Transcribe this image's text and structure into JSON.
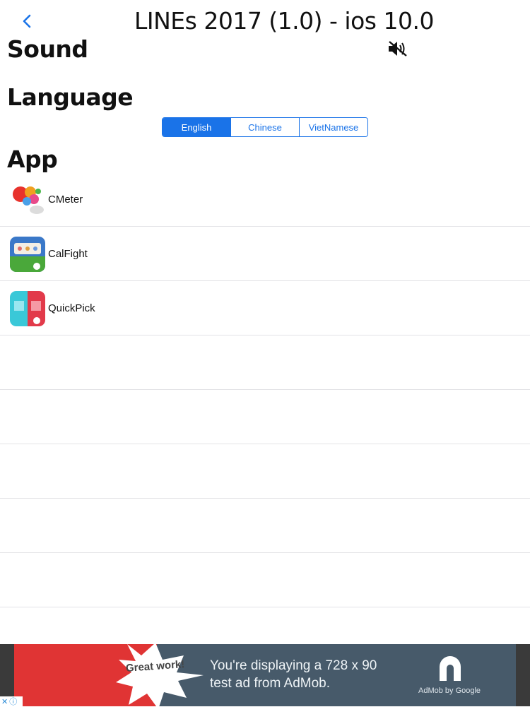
{
  "header": {
    "title": "LINEs 2017 (1.0) - ios 10.0",
    "back_icon": "chevron-left-icon"
  },
  "sections": {
    "sound": "Sound",
    "language": "Language",
    "app": "App"
  },
  "sound": {
    "icon": "speaker-muted-icon",
    "muted": true
  },
  "language": {
    "options": [
      "English",
      "Chinese",
      "VietNamese"
    ],
    "selected": "English"
  },
  "apps": [
    {
      "name": "CMeter"
    },
    {
      "name": "CalFight"
    },
    {
      "name": "QuickPick"
    }
  ],
  "ad": {
    "badge": "Great work!",
    "line1": "You're displaying a 728 x 90",
    "line2": "test ad from AdMob.",
    "brand": "AdMob by Google"
  },
  "colors": {
    "accent": "#1a73e8",
    "divider": "#e3e3e6",
    "ad_bg": "#475a6a",
    "ad_red": "#e03434"
  }
}
